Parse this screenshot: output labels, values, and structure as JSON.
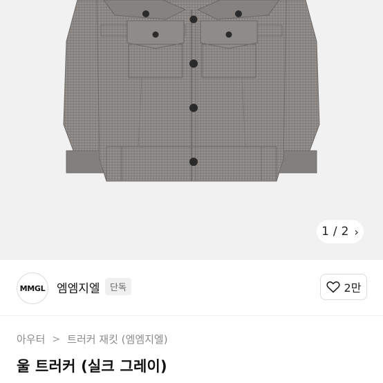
{
  "gallery": {
    "pager_current": "1",
    "pager_sep": "/",
    "pager_total": "2",
    "next_icon": "chevron-right-icon"
  },
  "seller": {
    "logo_text": "MMGL",
    "name": "엠엠지엘",
    "badge": "단독",
    "likes": "2만",
    "like_icon": "heart-outline-icon"
  },
  "breadcrumb": {
    "items": [
      "아우터",
      "트러커 재킷 (엠엠지엘)"
    ],
    "separator": ">"
  },
  "product": {
    "title": "울 트러커 (실크 그레이)"
  },
  "colors": {
    "jacket": "#8a8683",
    "background": "#f1f1f1",
    "button": "#2a2a2a"
  }
}
